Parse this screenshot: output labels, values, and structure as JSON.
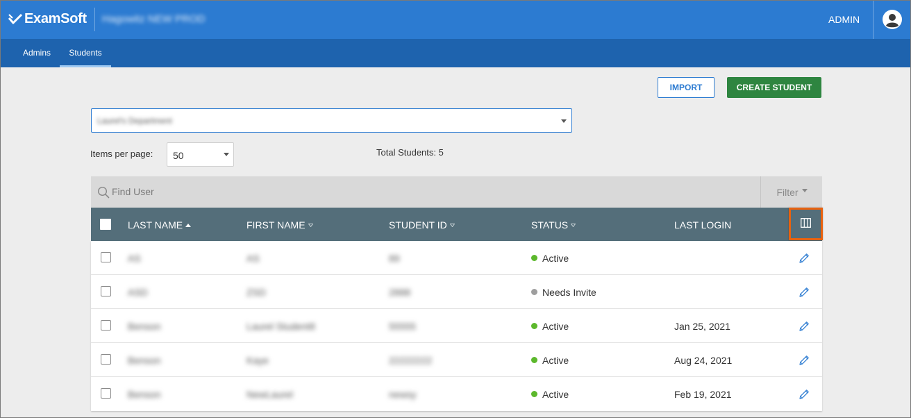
{
  "header": {
    "logo_text": "ExamSoft",
    "org_name": "Hagowitz NEW PROD",
    "user_role": "ADMIN"
  },
  "nav": {
    "tabs": [
      {
        "label": "Admins",
        "active": false
      },
      {
        "label": "Students",
        "active": true
      }
    ]
  },
  "actions": {
    "import_label": "IMPORT",
    "create_label": "CREATE STUDENT"
  },
  "department": {
    "selected": "Laurel's Department"
  },
  "pagination": {
    "items_per_page_label": "Items per page:",
    "items_per_page_value": "50",
    "total_label": "Total Students: 5"
  },
  "search": {
    "placeholder": "Find User",
    "filter_label": "Filter"
  },
  "table": {
    "columns": {
      "last_name": "LAST NAME",
      "first_name": "FIRST NAME",
      "student_id": "STUDENT ID",
      "status": "STATUS",
      "last_login": "LAST LOGIN"
    },
    "rows": [
      {
        "last_name": "AS",
        "first_name": "AS",
        "student_id": "89",
        "status": "Active",
        "last_login": ""
      },
      {
        "last_name": "ASD",
        "first_name": "ZSD",
        "student_id": "2888",
        "status": "Needs Invite",
        "last_login": ""
      },
      {
        "last_name": "Benson",
        "first_name": "Laurel Student8",
        "student_id": "55555",
        "status": "Active",
        "last_login": "Jan 25, 2021"
      },
      {
        "last_name": "Benson",
        "first_name": "Kaye",
        "student_id": "22222222",
        "status": "Active",
        "last_login": "Aug 24, 2021"
      },
      {
        "last_name": "Benson",
        "first_name": "NewLaurel",
        "student_id": "newsy",
        "status": "Active",
        "last_login": "Feb 19, 2021"
      }
    ]
  },
  "colors": {
    "topbar": "#2c7bd1",
    "navbar": "#1e63ae",
    "table_header": "#546e7a",
    "create_button": "#2e8540",
    "status_active": "#5cb82c",
    "status_needs_invite": "#9e9e9e",
    "highlight": "#e8620f"
  }
}
